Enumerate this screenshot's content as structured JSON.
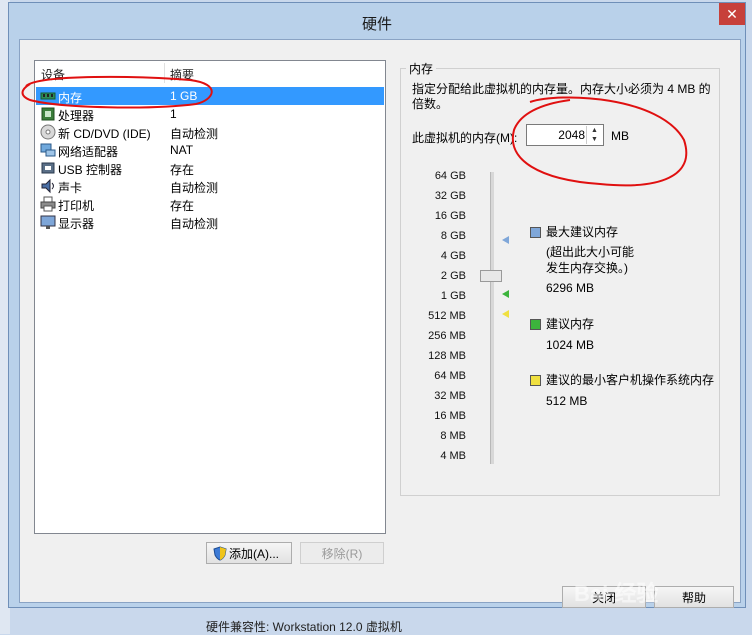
{
  "window": {
    "title": "硬件",
    "close_glyph": "✕"
  },
  "device_list": {
    "headers": {
      "device": "设备",
      "summary": "摘要"
    },
    "items": [
      {
        "name": "内存",
        "summary": "1 GB",
        "icon": "memory-icon",
        "selected": true
      },
      {
        "name": "处理器",
        "summary": "1",
        "icon": "processor-icon"
      },
      {
        "name": "新 CD/DVD (IDE)",
        "summary": "自动检测",
        "icon": "cd-dvd-icon"
      },
      {
        "name": "网络适配器",
        "summary": "NAT",
        "icon": "network-adapter-icon"
      },
      {
        "name": "USB 控制器",
        "summary": "存在",
        "icon": "usb-icon"
      },
      {
        "name": "声卡",
        "summary": "自动检测",
        "icon": "sound-card-icon"
      },
      {
        "name": "打印机",
        "summary": "存在",
        "icon": "printer-icon"
      },
      {
        "name": "显示器",
        "summary": "自动检测",
        "icon": "display-icon"
      }
    ],
    "add_button": "添加(A)...",
    "remove_button": "移除(R)"
  },
  "memory": {
    "group_title": "内存",
    "description": "指定分配给此虚拟机的内存量。内存大小必须为 4 MB 的倍数。",
    "field_label": "此虚拟机的内存(M):",
    "value": "2048",
    "unit": "MB",
    "scale": [
      "64 GB",
      "32 GB",
      "16 GB",
      "8 GB",
      "4 GB",
      "2 GB",
      "1 GB",
      "512 MB",
      "256 MB",
      "128 MB",
      "64 MB",
      "32 MB",
      "16 MB",
      "8 MB",
      "4 MB"
    ],
    "legend": {
      "max": {
        "title": "最大建议内存",
        "note1": "(超出此大小可能",
        "note2": "发生内存交换。)",
        "value": "6296 MB",
        "color": "#7fa7d9"
      },
      "recommended": {
        "title": "建议内存",
        "value": "1024 MB",
        "color": "#3cb43c"
      },
      "min": {
        "title": "建议的最小客户机操作系统内存",
        "value": "512 MB",
        "color": "#f0e040"
      }
    }
  },
  "footer": {
    "close_button": "关闭",
    "help_button": "帮助"
  },
  "background": {
    "text_bottom": "硬件兼容性: Workstation 12.0 虚拟机"
  },
  "watermark": "Bai 经验"
}
